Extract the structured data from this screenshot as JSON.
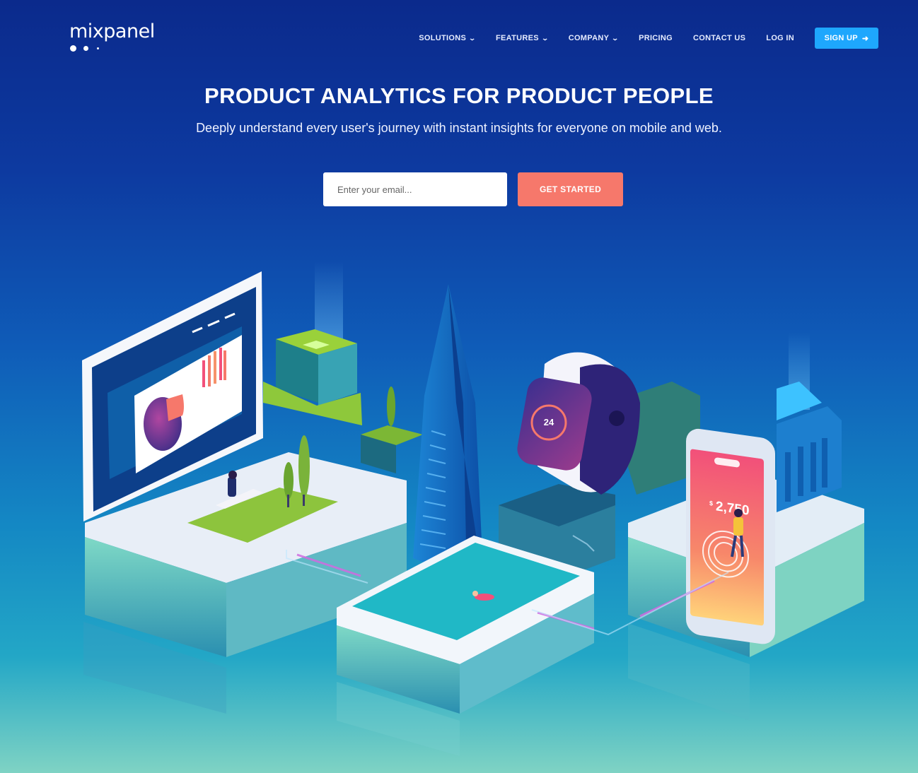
{
  "brand": {
    "name": "mixpanel"
  },
  "nav": {
    "items": [
      {
        "label": "SOLUTIONS",
        "has_dropdown": true
      },
      {
        "label": "FEATURES",
        "has_dropdown": true
      },
      {
        "label": "COMPANY",
        "has_dropdown": true
      },
      {
        "label": "PRICING",
        "has_dropdown": false
      },
      {
        "label": "CONTACT US",
        "has_dropdown": false
      },
      {
        "label": "LOG IN",
        "has_dropdown": false
      }
    ],
    "signup_label": "SIGN UP",
    "signup_icon": "arrow-right-icon"
  },
  "hero": {
    "title": "PRODUCT ANALYTICS FOR PRODUCT PEOPLE",
    "subtitle": "Deeply understand every user's journey with instant insights for everyone on mobile and web.",
    "email_placeholder": "Enter your email...",
    "cta_label": "GET STARTED"
  },
  "illustration": {
    "watch_value": "24",
    "phone_amount": "2,750",
    "phone_currency": "$"
  },
  "colors": {
    "accent_blue": "#1ea7fd",
    "cta_coral": "#f6786b",
    "bg_top": "#0b2a8c",
    "bg_bottom": "#7fd3c4"
  }
}
